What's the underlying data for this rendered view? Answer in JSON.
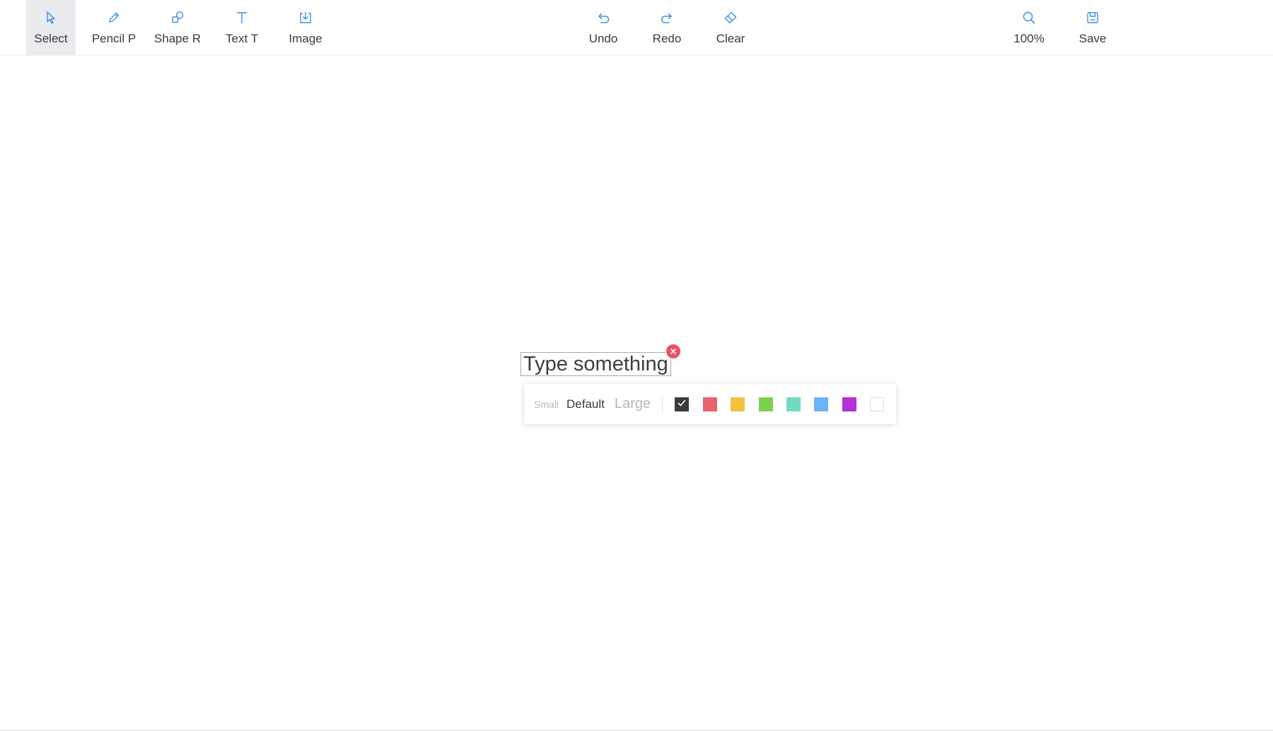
{
  "toolbar": {
    "left_tools": [
      {
        "id": "select",
        "label": "Select",
        "icon": "cursor-arrow-icon",
        "active": true
      },
      {
        "id": "pencil",
        "label": "Pencil P",
        "icon": "pencil-icon",
        "active": false
      },
      {
        "id": "shape",
        "label": "Shape R",
        "icon": "shapes-icon",
        "active": false
      },
      {
        "id": "text",
        "label": "Text T",
        "icon": "text-icon",
        "active": false
      },
      {
        "id": "image",
        "label": "Image",
        "icon": "image-upload-icon",
        "active": false
      }
    ],
    "center_tools": [
      {
        "id": "undo",
        "label": "Undo",
        "icon": "undo-icon"
      },
      {
        "id": "redo",
        "label": "Redo",
        "icon": "redo-icon"
      },
      {
        "id": "clear",
        "label": "Clear",
        "icon": "eraser-icon"
      }
    ],
    "right_tools": [
      {
        "id": "zoom",
        "label": "100%",
        "icon": "zoom-icon"
      },
      {
        "id": "save",
        "label": "Save",
        "icon": "floppy-disk-icon"
      }
    ]
  },
  "canvas": {
    "text_editor": {
      "value": "Type something",
      "close_icon": "close-icon"
    },
    "text_options": {
      "sizes": [
        {
          "id": "small",
          "label": "Small",
          "selected": false
        },
        {
          "id": "default",
          "label": "Default",
          "selected": true
        },
        {
          "id": "large",
          "label": "Large",
          "selected": false
        }
      ],
      "colors": [
        {
          "name": "black",
          "hex": "#3b3b3b",
          "selected": true
        },
        {
          "name": "red",
          "hex": "#e8636b",
          "selected": false
        },
        {
          "name": "yellow",
          "hex": "#f3c03f",
          "selected": false
        },
        {
          "name": "green",
          "hex": "#7ed04f",
          "selected": false
        },
        {
          "name": "teal",
          "hex": "#6fdcc0",
          "selected": false
        },
        {
          "name": "blue",
          "hex": "#6db4f7",
          "selected": false
        },
        {
          "name": "purple",
          "hex": "#b231d8",
          "selected": false
        },
        {
          "name": "white",
          "hex": "#ffffff",
          "selected": false
        }
      ]
    }
  },
  "colors": {
    "accent_icon": "#3d8fe6",
    "active_tool_bg": "#e9ebee",
    "close_button": "#e8525f"
  }
}
